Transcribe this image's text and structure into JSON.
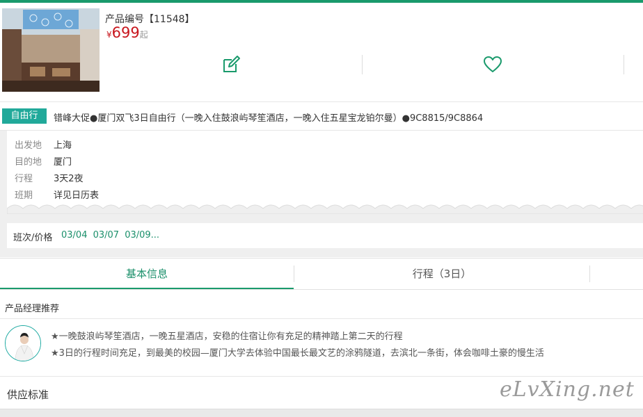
{
  "product": {
    "code_label": "产品编号【11548】",
    "currency_symbol": "¥",
    "price": "699",
    "price_suffix": "起"
  },
  "actions": {
    "edit_icon": "edit-icon",
    "favorite_icon": "heart-icon"
  },
  "title": {
    "badge": "自由行",
    "text": "错峰大促●厦门双飞3日自由行（一晚入住鼓浪屿琴笙酒店，一晚入住五星宝龙铂尔曼）●9C8815/9C8864"
  },
  "info": {
    "rows": [
      {
        "key": "出发地",
        "value": "上海"
      },
      {
        "key": "目的地",
        "value": "厦门"
      },
      {
        "key": "行程",
        "value": "3天2夜"
      },
      {
        "key": "班期",
        "value": "详见日历表"
      }
    ]
  },
  "schedule": {
    "label": "班次/价格",
    "dates": "03/04  03/07  03/09..."
  },
  "tabs": [
    {
      "label": "基本信息",
      "active": true
    },
    {
      "label": "行程（3日）",
      "active": false
    }
  ],
  "recommend": {
    "title": "产品经理推荐",
    "items": [
      "★一晚鼓浪屿琴笙酒店，一晚五星酒店，安稳的住宿让你有充足的精神踏上第二天的行程",
      "★3日的行程时间充足，到最美的校园—厦门大学去体验中国最长最文艺的涂鸦隧道，去滨北一条街，体会咖啡土豪的慢生活"
    ]
  },
  "supply": {
    "label": "供应标准"
  },
  "watermark": "eLvXing.net",
  "colors": {
    "accent": "#1a9a6c",
    "badge": "#21a99a",
    "price": "#c8161d"
  }
}
